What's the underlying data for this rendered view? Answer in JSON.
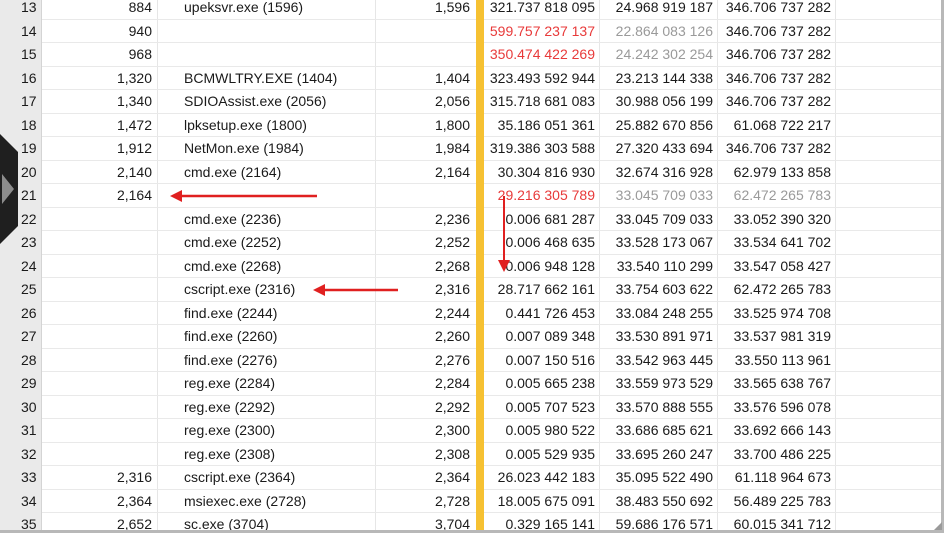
{
  "table": {
    "rows": [
      {
        "n": "13",
        "pid": "884",
        "proc": "upeksvr.exe (1596)",
        "pid2": "1,596",
        "v1": "321.737 818 095",
        "v2": "24.968 919 187",
        "v3": "346.706 737 282",
        "exp": ""
      },
      {
        "n": "14",
        "pid": "940",
        "proc": "",
        "pid2": "",
        "v1": "599.757 237 137",
        "v2": "22.864 083 126",
        "v3": "346.706 737 282",
        "exp": "+",
        "s1": "red",
        "s2": "grey"
      },
      {
        "n": "15",
        "pid": "968",
        "proc": "",
        "pid2": "",
        "v1": "350.474 422 269",
        "v2": "24.242 302 254",
        "v3": "346.706 737 282",
        "exp": "+",
        "s1": "red",
        "s2": "grey"
      },
      {
        "n": "16",
        "pid": "1,320",
        "proc": "BCMWLTRY.EXE (1404)",
        "pid2": "1,404",
        "v1": "323.493 592 944",
        "v2": "23.213 144 338",
        "v3": "346.706 737 282",
        "exp": ""
      },
      {
        "n": "17",
        "pid": "1,340",
        "proc": "SDIOAssist.exe (2056)",
        "pid2": "2,056",
        "v1": "315.718 681 083",
        "v2": "30.988 056 199",
        "v3": "346.706 737 282",
        "exp": ""
      },
      {
        "n": "18",
        "pid": "1,472",
        "proc": "lpksetup.exe (1800)",
        "pid2": "1,800",
        "v1": "35.186 051 361",
        "v2": "25.882 670 856",
        "v3": "61.068 722 217",
        "exp": ""
      },
      {
        "n": "19",
        "pid": "1,912",
        "proc": "NetMon.exe (1984)",
        "pid2": "1,984",
        "v1": "319.386 303 588",
        "v2": "27.320 433 694",
        "v3": "346.706 737 282",
        "exp": ""
      },
      {
        "n": "20",
        "pid": "2,140",
        "proc": "cmd.exe (2164)",
        "pid2": "2,164",
        "v1": "30.304 816 930",
        "v2": "32.674 316 928",
        "v3": "62.979 133 858",
        "exp": ""
      },
      {
        "n": "21",
        "pid": "2,164",
        "proc": "",
        "pid2": "",
        "v1": "29.216 305 789",
        "v2": "33.045 709 033",
        "v3": "62.472 265 783",
        "exp": "−",
        "s1": "red",
        "s2": "grey",
        "s3": "grey"
      },
      {
        "n": "22",
        "pid": "",
        "proc": "cmd.exe (2236)",
        "pid2": "2,236",
        "v1": "0.006 681 287",
        "v2": "33.045 709 033",
        "v3": "33.052 390 320",
        "exp": ""
      },
      {
        "n": "23",
        "pid": "",
        "proc": "cmd.exe (2252)",
        "pid2": "2,252",
        "v1": "0.006 468 635",
        "v2": "33.528 173 067",
        "v3": "33.534 641 702",
        "exp": ""
      },
      {
        "n": "24",
        "pid": "",
        "proc": "cmd.exe (2268)",
        "pid2": "2,268",
        "v1": "0.006 948 128",
        "v2": "33.540 110 299",
        "v3": "33.547 058 427",
        "exp": ""
      },
      {
        "n": "25",
        "pid": "",
        "proc": "cscript.exe (2316)",
        "pid2": "2,316",
        "v1": "28.717 662 161",
        "v2": "33.754 603 622",
        "v3": "62.472 265 783",
        "exp": ""
      },
      {
        "n": "26",
        "pid": "",
        "proc": "find.exe (2244)",
        "pid2": "2,244",
        "v1": "0.441 726 453",
        "v2": "33.084 248 255",
        "v3": "33.525 974 708",
        "exp": ""
      },
      {
        "n": "27",
        "pid": "",
        "proc": "find.exe (2260)",
        "pid2": "2,260",
        "v1": "0.007 089 348",
        "v2": "33.530 891 971",
        "v3": "33.537 981 319",
        "exp": ""
      },
      {
        "n": "28",
        "pid": "",
        "proc": "find.exe (2276)",
        "pid2": "2,276",
        "v1": "0.007 150 516",
        "v2": "33.542 963 445",
        "v3": "33.550 113 961",
        "exp": ""
      },
      {
        "n": "29",
        "pid": "",
        "proc": "reg.exe (2284)",
        "pid2": "2,284",
        "v1": "0.005 665 238",
        "v2": "33.559 973 529",
        "v3": "33.565 638 767",
        "exp": ""
      },
      {
        "n": "30",
        "pid": "",
        "proc": "reg.exe (2292)",
        "pid2": "2,292",
        "v1": "0.005 707 523",
        "v2": "33.570 888 555",
        "v3": "33.576 596 078",
        "exp": ""
      },
      {
        "n": "31",
        "pid": "",
        "proc": "reg.exe (2300)",
        "pid2": "2,300",
        "v1": "0.005 980 522",
        "v2": "33.686 685 621",
        "v3": "33.692 666 143",
        "exp": ""
      },
      {
        "n": "32",
        "pid": "",
        "proc": "reg.exe (2308)",
        "pid2": "2,308",
        "v1": "0.005 529 935",
        "v2": "33.695 260 247",
        "v3": "33.700 486 225",
        "exp": ""
      },
      {
        "n": "33",
        "pid": "2,316",
        "proc": "cscript.exe (2364)",
        "pid2": "2,364",
        "v1": "26.023 442 183",
        "v2": "35.095 522 490",
        "v3": "61.118 964 673",
        "exp": ""
      },
      {
        "n": "34",
        "pid": "2,364",
        "proc": "msiexec.exe (2728)",
        "pid2": "2,728",
        "v1": "18.005 675 091",
        "v2": "38.483 550 692",
        "v3": "56.489 225 783",
        "exp": ""
      },
      {
        "n": "35",
        "pid": "2,652",
        "proc": "sc.exe (3704)",
        "pid2": "3,704",
        "v1": "0.329 165 141",
        "v2": "59.686 176 571",
        "v3": "60.015 341 712",
        "exp": ""
      }
    ]
  },
  "colors": {
    "accent_column": "#f6c132",
    "highlight_text": "#e83a3a",
    "muted_text": "#9a9a9a",
    "annotation_arrow": "#e02020"
  },
  "icons": {
    "expand": "plus-box-icon",
    "collapse": "minus-box-icon",
    "side_tab": "chevron-right-icon"
  }
}
